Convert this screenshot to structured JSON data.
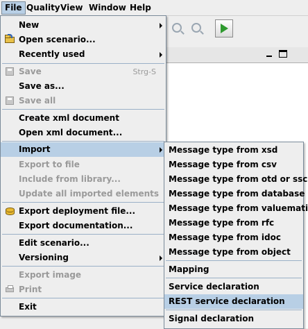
{
  "menubar": {
    "items": [
      {
        "label": "File",
        "active": true
      },
      {
        "label": "Quality"
      },
      {
        "label": "View"
      },
      {
        "label": "Window"
      },
      {
        "label": "Help"
      }
    ]
  },
  "toolbar": {
    "icons": [
      "zoom-in-icon",
      "zoom-out-icon",
      "run-icon"
    ]
  },
  "file_menu": {
    "items": {
      "new": {
        "label": "New",
        "submenu": true
      },
      "open_scenario": {
        "label": "Open scenario...",
        "icon": "open-folder-icon"
      },
      "recently_used": {
        "label": "Recently used",
        "submenu": true
      },
      "save": {
        "label": "Save",
        "accelerator": "Strg-S",
        "enabled": false,
        "icon": "save-icon"
      },
      "save_as": {
        "label": "Save as..."
      },
      "save_all": {
        "label": "Save all",
        "enabled": false,
        "icon": "save-all-icon"
      },
      "create_xml": {
        "label": "Create xml document"
      },
      "open_xml": {
        "label": "Open xml document..."
      },
      "import": {
        "label": "Import",
        "submenu": true,
        "selected": true
      },
      "export_to_file": {
        "label": "Export to file",
        "enabled": false
      },
      "include_from_library": {
        "label": "Include from library...",
        "enabled": false
      },
      "update_imported": {
        "label": "Update all imported elements",
        "enabled": false
      },
      "export_deployment": {
        "label": "Export deployment file...",
        "icon": "database-icon"
      },
      "export_documentation": {
        "label": "Export documentation..."
      },
      "edit_scenario": {
        "label": "Edit scenario..."
      },
      "versioning": {
        "label": "Versioning",
        "submenu": true
      },
      "export_image": {
        "label": "Export image",
        "enabled": false
      },
      "print": {
        "label": "Print",
        "enabled": false,
        "icon": "printer-icon"
      },
      "exit": {
        "label": "Exit"
      }
    }
  },
  "import_submenu": {
    "items": {
      "xsd": {
        "label": "Message type from xsd"
      },
      "csv": {
        "label": "Message type from csv"
      },
      "otd": {
        "label": "Message type from otd or ssc"
      },
      "database": {
        "label": "Message type from database"
      },
      "valuemation": {
        "label": "Message type from valuemation"
      },
      "rfc": {
        "label": "Message type from rfc"
      },
      "idoc": {
        "label": "Message type from idoc"
      },
      "object": {
        "label": "Message type from object"
      },
      "mapping": {
        "label": "Mapping"
      },
      "service": {
        "label": "Service declaration"
      },
      "rest": {
        "label": "REST service declaration",
        "selected": true
      },
      "signal": {
        "label": "Signal declaration"
      }
    }
  },
  "colors": {
    "selection": "#b8cfe5",
    "menu_background": "#eeeeee",
    "disabled_text": "#9a9a9a",
    "menu_border": "#7a8a99"
  }
}
